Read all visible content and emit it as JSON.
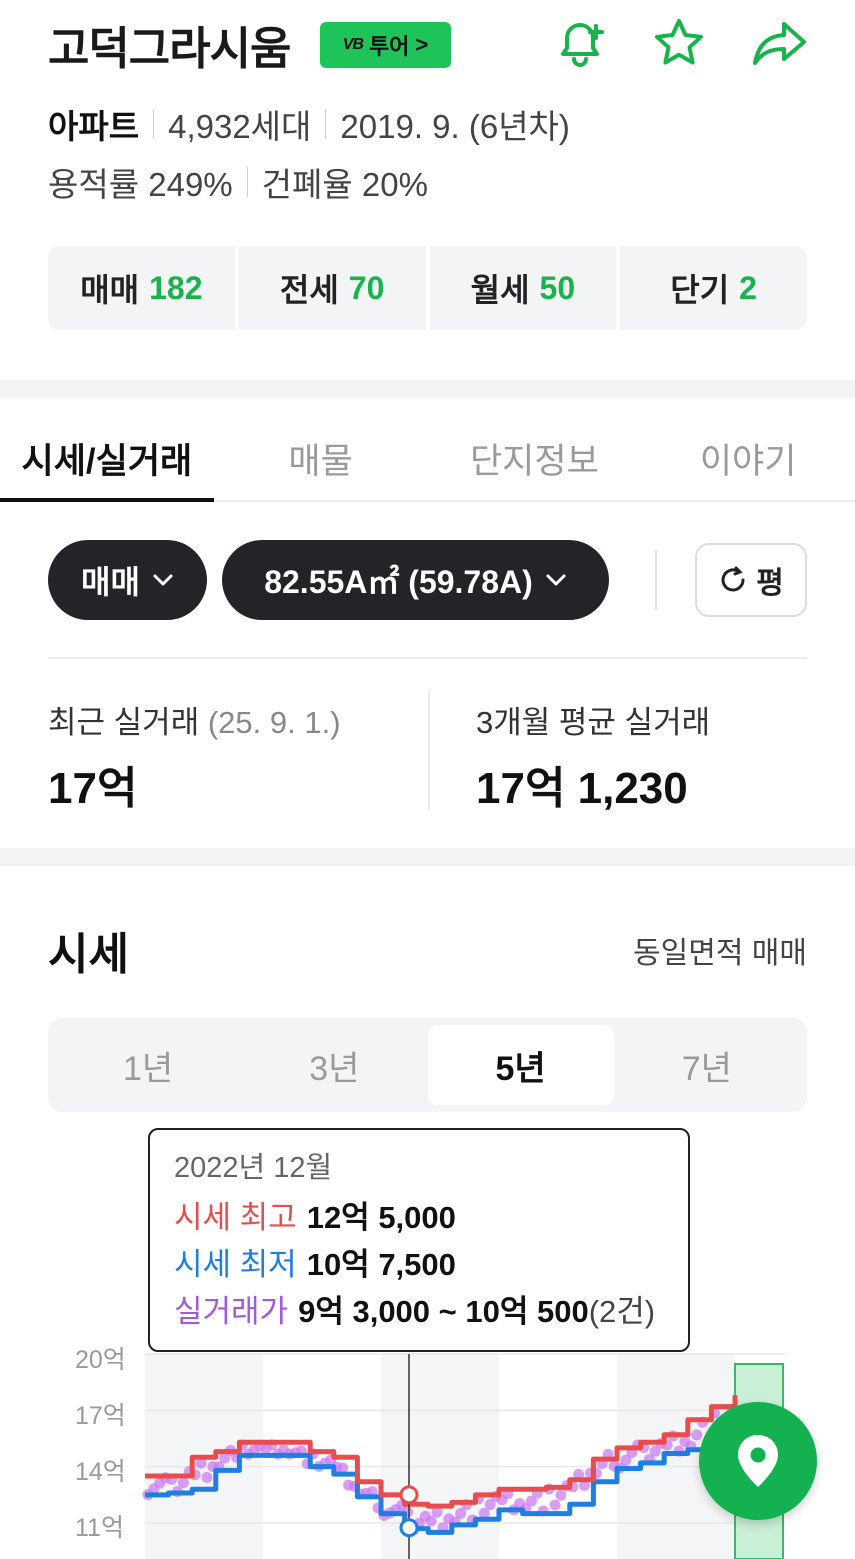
{
  "header": {
    "title": "고덕그라시움",
    "tour_badge": {
      "logo": "VB",
      "label": "투어",
      "chevron": ">"
    },
    "icons": [
      "bell-plus-icon",
      "star-icon",
      "share-icon"
    ],
    "accent_color": "#1ec35a"
  },
  "info": {
    "type": "아파트",
    "households": "4,932세대",
    "completion": "2019. 9. (6년차)",
    "floor_area_ratio": "용적률 249%",
    "coverage_ratio": "건폐율 20%"
  },
  "counts": [
    {
      "label": "매매",
      "value": "182"
    },
    {
      "label": "전세",
      "value": "70"
    },
    {
      "label": "월세",
      "value": "50"
    },
    {
      "label": "단기",
      "value": "2"
    }
  ],
  "tabs": [
    "시세/실거래",
    "매물",
    "단지정보",
    "이야기"
  ],
  "filters": {
    "deal_type": "매매",
    "area": "82.55A㎡ (59.78A)",
    "unit_toggle": "평"
  },
  "stats": {
    "recent_label": "최근 실거래",
    "recent_date": "(25. 9. 1.)",
    "recent_value": "17억",
    "avg_label": "3개월 평균 실거래",
    "avg_value": "17억 1,230"
  },
  "price_section": {
    "title": "시세",
    "link": "동일면적 매매",
    "periods": [
      "1년",
      "3년",
      "5년",
      "7년"
    ],
    "active_period": "5년"
  },
  "tooltip": {
    "date": "2022년 12월",
    "high_label": "시세 최고",
    "high_value": "12억 5,000",
    "low_label": "시세 최저",
    "low_value": "10억 7,500",
    "trade_label": "실거래가",
    "trade_value": "9억 3,000 ~ 10억 500",
    "trade_count": "(2건)"
  },
  "colors": {
    "high": "#e84c4c",
    "low": "#1e7fe0",
    "trade": "#a05ae0",
    "count_number": "#19b34c"
  },
  "chart_data": {
    "type": "line",
    "y_ticks": [
      "20억",
      "17억",
      "14억",
      "11억"
    ],
    "ylim": [
      10,
      20
    ],
    "series": [
      {
        "name": "시세 최고",
        "values": [
          13.5,
          13.5,
          14.5,
          14.8,
          15.3,
          15.3,
          15.3,
          14.8,
          14.5,
          13.2,
          12.5,
          12.0,
          11.9,
          12.1,
          12.5,
          12.8,
          12.8,
          12.9,
          13.3,
          14.4,
          15.0,
          15.3,
          15.7,
          16.5,
          17.2,
          17.8
        ]
      },
      {
        "name": "시세 최저",
        "values": [
          12.5,
          12.6,
          12.8,
          13.8,
          14.6,
          14.6,
          14.6,
          14.0,
          13.6,
          12.4,
          11.5,
          10.7,
          10.5,
          10.9,
          11.2,
          11.7,
          11.5,
          11.5,
          12.0,
          13.2,
          13.9,
          14.2,
          14.7,
          14.9,
          15.1,
          15.3
        ]
      }
    ],
    "highlight": {
      "date": "2022년 12월",
      "high": 12.5,
      "low": 10.75
    }
  }
}
